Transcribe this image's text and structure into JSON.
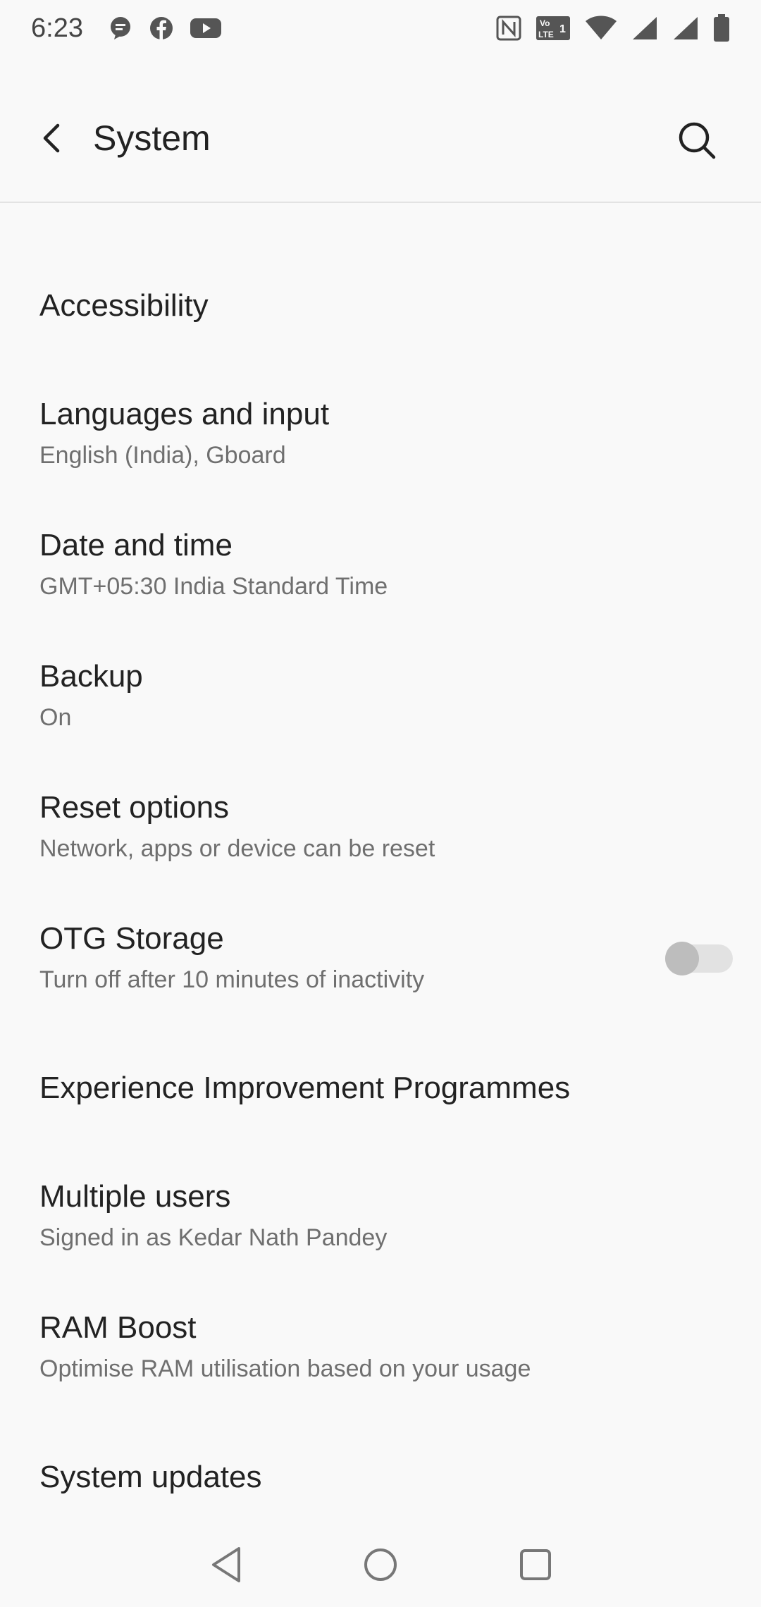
{
  "status_bar": {
    "time": "6:23",
    "left_icons": [
      "messaging-icon",
      "facebook-icon",
      "youtube-icon"
    ],
    "right_icons": [
      "nfc-icon",
      "volte-icon",
      "wifi-icon",
      "signal-icon",
      "signal-icon",
      "battery-icon"
    ]
  },
  "app_bar": {
    "title": "System"
  },
  "items": [
    {
      "title": "Accessibility",
      "subtitle": ""
    },
    {
      "title": "Languages and input",
      "subtitle": "English (India), Gboard"
    },
    {
      "title": "Date and time",
      "subtitle": "GMT+05:30 India Standard Time"
    },
    {
      "title": "Backup",
      "subtitle": "On"
    },
    {
      "title": "Reset options",
      "subtitle": "Network, apps or device can be reset"
    },
    {
      "title": "OTG Storage",
      "subtitle": "Turn off after 10 minutes of inactivity",
      "toggle": false
    },
    {
      "title": "Experience Improvement Programmes",
      "subtitle": ""
    },
    {
      "title": "Multiple users",
      "subtitle": "Signed in as Kedar Nath Pandey"
    },
    {
      "title": "RAM Boost",
      "subtitle": "Optimise RAM utilisation based on your usage"
    },
    {
      "title": "System updates",
      "subtitle": ""
    }
  ],
  "nav_bar": {
    "buttons": [
      "back-nav-icon",
      "home-nav-icon",
      "recents-nav-icon"
    ]
  },
  "colors": {
    "background": "#f9f9f9",
    "title_text": "#222222",
    "subtitle_text": "#6f6f6f",
    "divider": "#e3e3e3",
    "toggle_off_track": "#e2e2e2",
    "toggle_off_thumb": "#bdbdbd"
  }
}
